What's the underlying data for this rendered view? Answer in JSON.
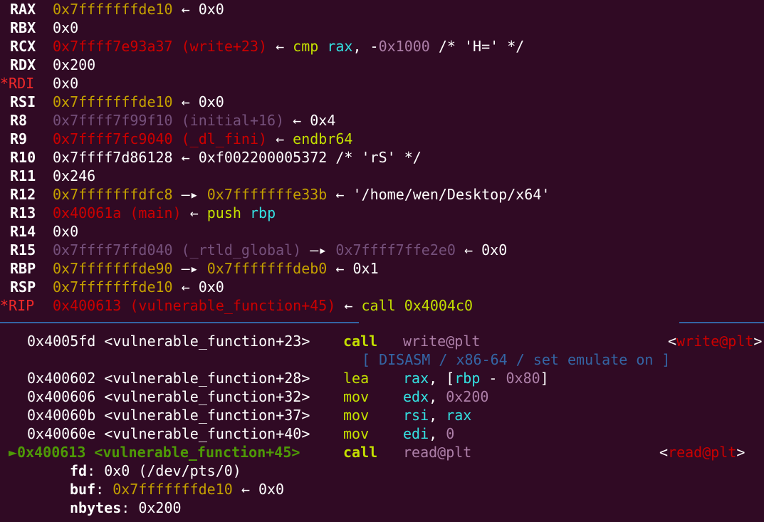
{
  "registers": [
    {
      "name": "RAX",
      "changed": false,
      "value": "0x7fffffffde10",
      "value_color": "yellow",
      "arrow": "←",
      "target": "0x0",
      "target_color": "white"
    },
    {
      "name": "RBX",
      "changed": false,
      "value": "0x0",
      "value_color": "white"
    },
    {
      "name": "RCX",
      "changed": false,
      "value": "0x7ffff7e93a37 (write+23)",
      "value_color": "red",
      "arrow": "←",
      "insn_mnemonic": "cmp",
      "insn_reg": "rax",
      "insn_sep": ", -",
      "insn_imm": "0x1000",
      "insn_comment": " /* 'H=' */"
    },
    {
      "name": "RDX",
      "changed": false,
      "value": "0x200",
      "value_color": "white"
    },
    {
      "name": "RDI",
      "changed": true,
      "value": "0x0",
      "value_color": "white"
    },
    {
      "name": "RSI",
      "changed": false,
      "value": "0x7fffffffde10",
      "value_color": "yellow",
      "arrow": "←",
      "target": "0x0",
      "target_color": "white"
    },
    {
      "name": "R8",
      "changed": false,
      "value": "0x7ffff7f99f10 (initial+16)",
      "value_color": "gray",
      "arrow": "←",
      "target": "0x4",
      "target_color": "white"
    },
    {
      "name": "R9",
      "changed": false,
      "value": "0x7ffff7fc9040 (_dl_fini)",
      "value_color": "red",
      "arrow": "←",
      "target": "endbr64",
      "target_color": "lime"
    },
    {
      "name": "R10",
      "changed": false,
      "value": "0x7ffff7d86128",
      "value_color": "white",
      "arrow": "←",
      "target": "0xf002200005372 /* 'rS' */",
      "target_color": "white"
    },
    {
      "name": "R11",
      "changed": false,
      "value": "0x246",
      "value_color": "white"
    },
    {
      "name": "R12",
      "changed": false,
      "value": "0x7fffffffdfc8",
      "value_color": "yellow",
      "arrow": "—▸",
      "target": "0x7fffffffe33b",
      "target_color": "yellow",
      "arrow2": "←",
      "target2": "'/home/wen/Desktop/x64'",
      "target2_color": "white"
    },
    {
      "name": "R13",
      "changed": false,
      "value": "0x40061a (main)",
      "value_color": "red",
      "arrow": "←",
      "insn_mnemonic": "push",
      "insn_reg": "rbp"
    },
    {
      "name": "R14",
      "changed": false,
      "value": "0x0",
      "value_color": "white"
    },
    {
      "name": "R15",
      "changed": false,
      "value": "0x7ffff7ffd040 (_rtld_global)",
      "value_color": "gray",
      "arrow": "—▸",
      "target": "0x7ffff7ffe2e0",
      "target_color": "gray",
      "arrow2": "←",
      "target2": "0x0",
      "target2_color": "white"
    },
    {
      "name": "RBP",
      "changed": false,
      "value": "0x7fffffffde90",
      "value_color": "yellow",
      "arrow": "—▸",
      "target": "0x7fffffffdeb0",
      "target_color": "yellow",
      "arrow2": "←",
      "target2": "0x1",
      "target2_color": "white"
    },
    {
      "name": "RSP",
      "changed": false,
      "value": "0x7fffffffde10",
      "value_color": "yellow",
      "arrow": "←",
      "target": "0x0",
      "target_color": "white"
    },
    {
      "name": "RIP",
      "changed": true,
      "value": "0x400613 (vulnerable_function+45)",
      "value_color": "red",
      "arrow": "←",
      "insn_mnemonic": "call",
      "insn_imm": "0x4004c0"
    }
  ],
  "divider_title": "[ DISASM / x86-64 / set emulate on ]",
  "disasm": [
    {
      "addr": "0x4005fd",
      "sym": "<vulnerable_function+23>",
      "mnemonic": "call",
      "operands": "write@plt",
      "target": "<write@plt>",
      "current": false,
      "bold_mnemonic": true
    },
    {
      "addr": "0x400602",
      "sym": "<vulnerable_function+28>",
      "mnemonic": "lea",
      "op_reg": "rax",
      "op_rest": ", [",
      "op_base": "rbp",
      "op_minus": " - ",
      "op_imm": "0x80",
      "op_close": "]",
      "current": false
    },
    {
      "addr": "0x400606",
      "sym": "<vulnerable_function+32>",
      "mnemonic": "mov",
      "op_reg": "edx",
      "op_sep": ", ",
      "op_imm": "0x200",
      "current": false
    },
    {
      "addr": "0x40060b",
      "sym": "<vulnerable_function+37>",
      "mnemonic": "mov",
      "op_reg": "rsi",
      "op_sep": ", ",
      "op_reg2": "rax",
      "current": false
    },
    {
      "addr": "0x40060e",
      "sym": "<vulnerable_function+40>",
      "mnemonic": "mov",
      "op_reg": "edi",
      "op_sep": ", ",
      "op_imm": "0",
      "current": false
    },
    {
      "addr": "0x400613",
      "sym": "<vulnerable_function+45>",
      "mnemonic": "call",
      "operands": "read@plt",
      "target": "<read@plt>",
      "current": true,
      "bold_mnemonic": true
    }
  ],
  "current_marker": "►",
  "args": [
    {
      "name": "fd",
      "value": "0x0 (/dev/pts/0)",
      "value_color": "white"
    },
    {
      "name": "buf",
      "value": "0x7fffffffde10",
      "value_color": "yellow",
      "arrow": "←",
      "target": "0x0"
    },
    {
      "name": "nbytes",
      "value": "0x200",
      "value_color": "white"
    }
  ]
}
